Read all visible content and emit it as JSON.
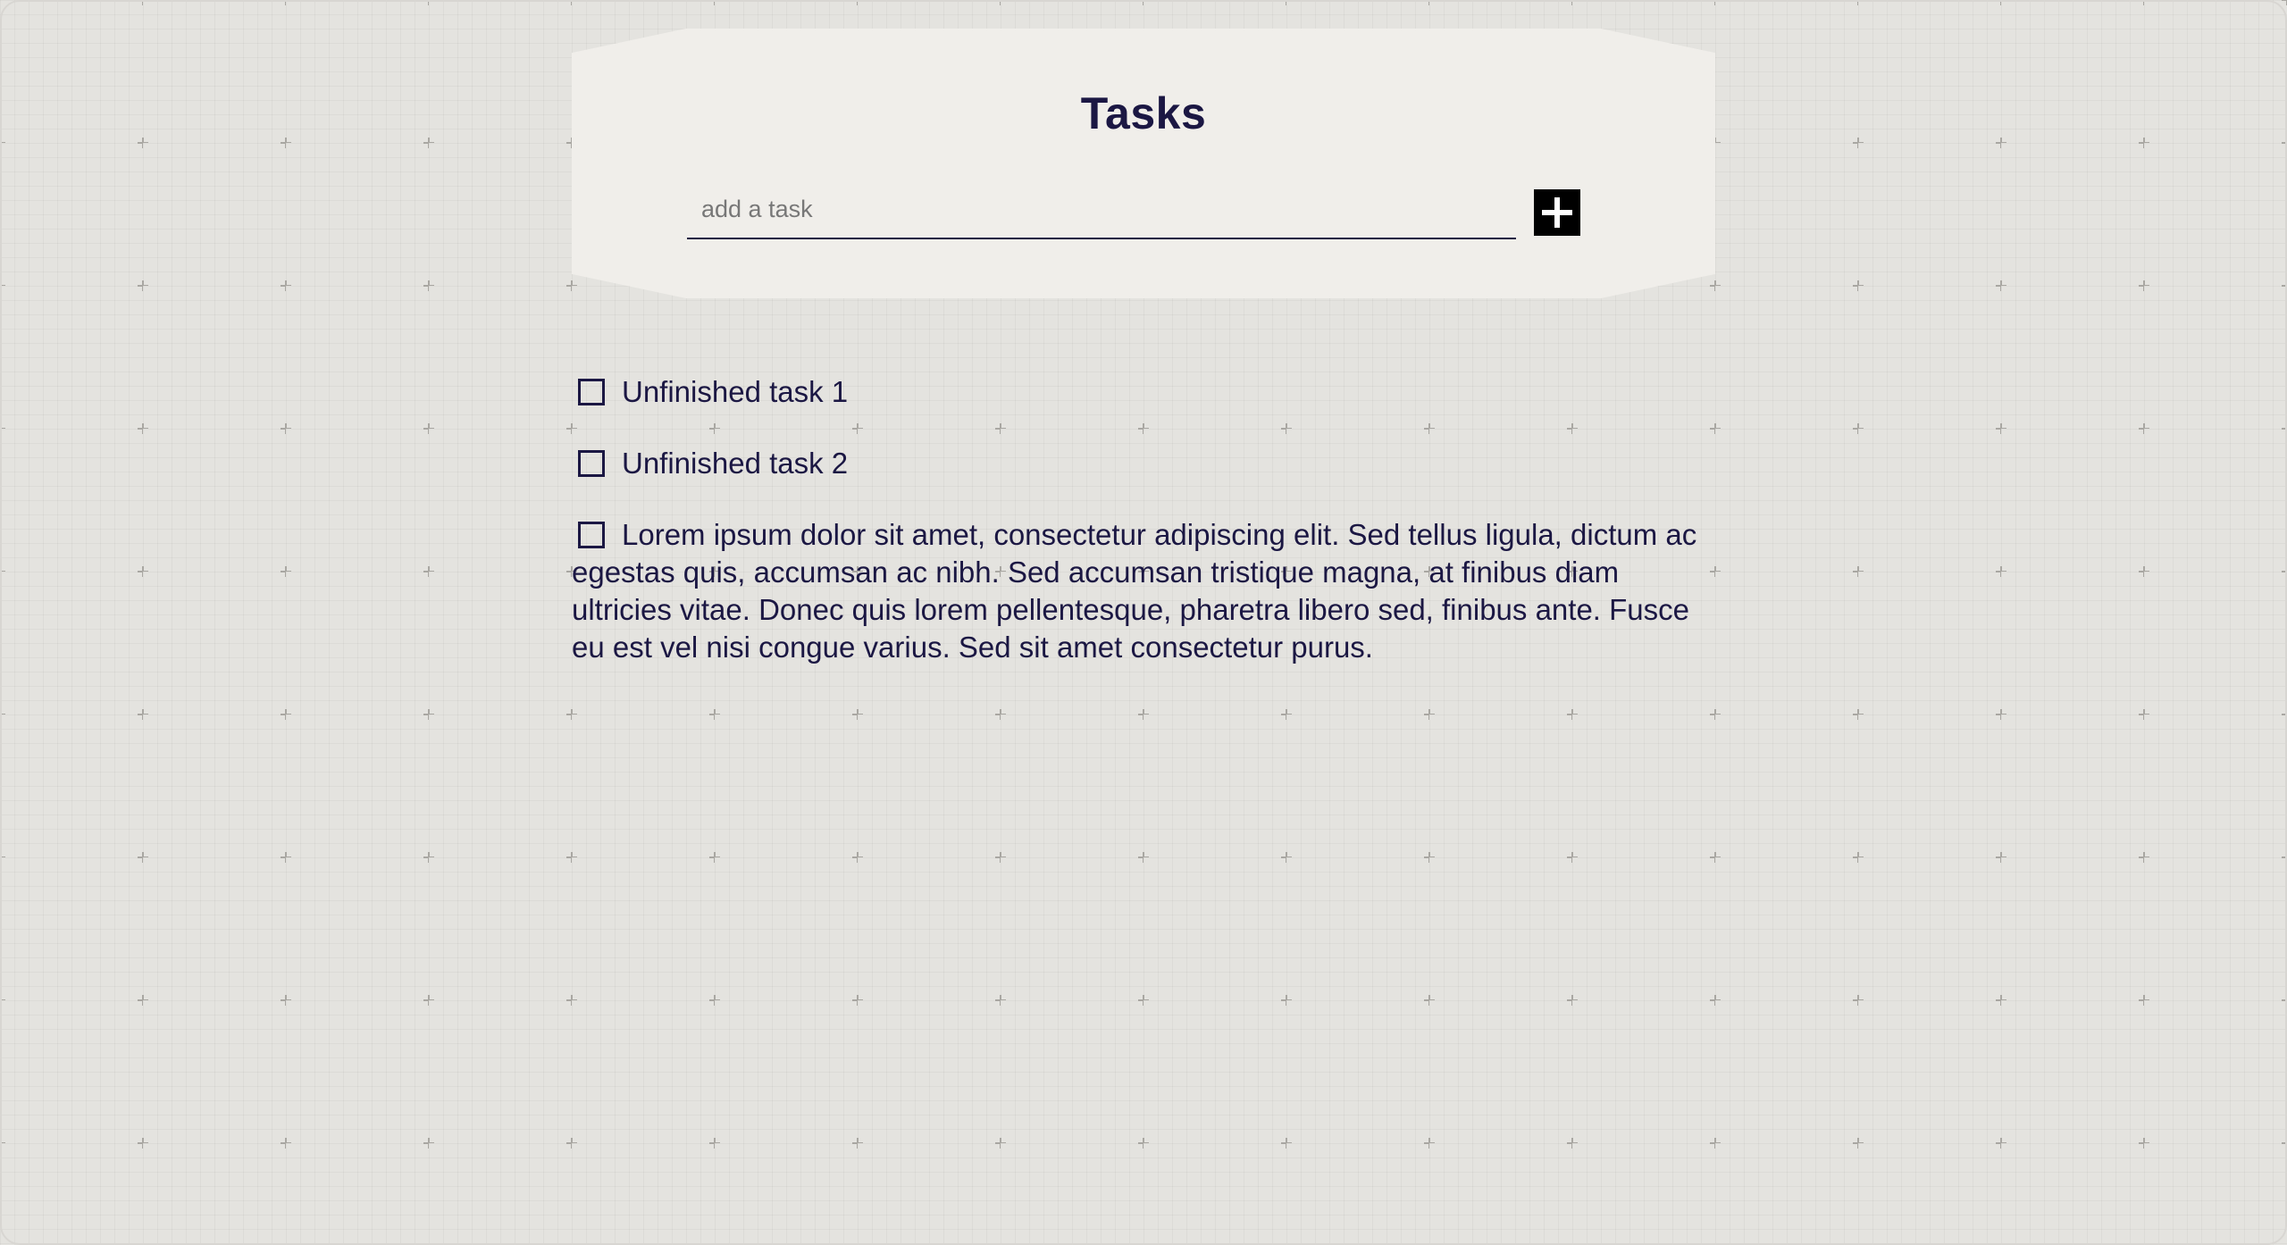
{
  "header": {
    "title": "Tasks",
    "input_placeholder": "add a task",
    "add_button_label": "Add task",
    "add_icon": "plus-icon"
  },
  "tasks": [
    {
      "text": "Unfinished task 1",
      "done": false
    },
    {
      "text": "Unfinished task 2",
      "done": false
    },
    {
      "text": "Lorem ipsum dolor sit amet, consectetur adipiscing elit. Sed tellus ligula, dictum ac egestas quis, accumsan ac nibh. Sed accumsan tristique magna, at finibus diam ultricies vitae. Donec quis lorem pellentesque, pharetra libero sed, finibus ante. Fusce eu est vel nisi congue varius. Sed sit amet consectetur purus.",
      "done": false
    }
  ],
  "colors": {
    "ink": "#1b1743",
    "card": "#f0eeea",
    "background": "#e4e3df",
    "button": "#000000"
  }
}
